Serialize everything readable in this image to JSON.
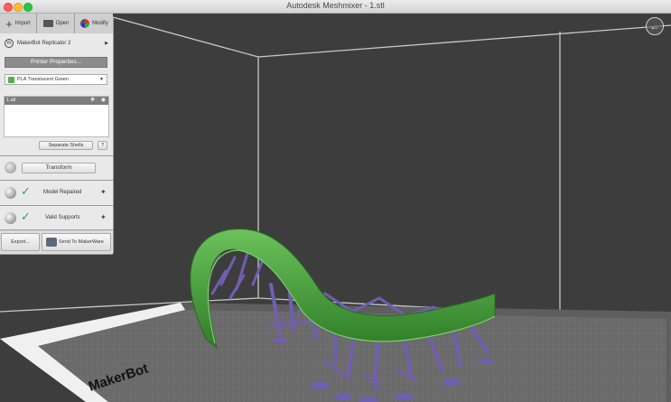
{
  "window": {
    "title": "Autodesk Meshmixer - 1.stl"
  },
  "toolbar": {
    "import_label": "Import",
    "open_label": "Open",
    "modify_label": "Modify"
  },
  "printer": {
    "name": "MakerBot Replicator 2",
    "properties_label": "Printer Properties...",
    "material": "PLA Translucent Green",
    "material_color": "#4fb34a"
  },
  "objects": {
    "items": [
      "1.stl"
    ],
    "separate_shells_label": "Separate Shells",
    "help_label": "?"
  },
  "transform": {
    "label": "Transform"
  },
  "status": {
    "model_repaired_label": "Model Repaired",
    "valid_supports_label": "Valid Supports"
  },
  "export": {
    "export_label": "Export...",
    "send_label": "Send To MakerWare"
  },
  "viewport": {
    "platform_text": "MakerBot"
  },
  "colors": {
    "model": "#48a63a",
    "supports": "#6f5fb0",
    "grid": "#6e6e6e",
    "background": "#3d3d3d",
    "check": "#2e9e6e"
  }
}
